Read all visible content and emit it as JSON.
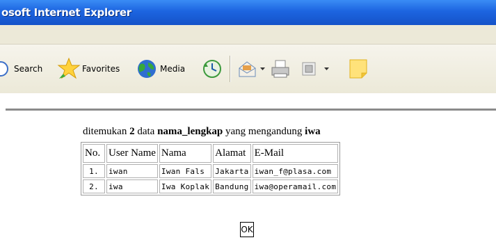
{
  "window": {
    "title": "osoft Internet Explorer"
  },
  "toolbar": {
    "search_label": "Search",
    "favorites_label": "Favorites",
    "media_label": "Media",
    "icons": [
      "search-icon",
      "favorites-star-icon",
      "media-globe-icon",
      "history-icon",
      "mail-icon",
      "print-icon",
      "edit-icon",
      "discuss-icon",
      "messenger-note-icon"
    ]
  },
  "result": {
    "prefix": "ditemukan",
    "count": "2",
    "middle1": "data",
    "field": "nama_lengkap",
    "middle2": "yang mengandung",
    "keyword": "iwa"
  },
  "table": {
    "headers": [
      "No.",
      "User Name",
      "Nama",
      "Alamat",
      "E-Mail"
    ],
    "rows": [
      [
        "1.",
        "iwan",
        "Iwan Fals",
        "Jakarta",
        "iwan_f@plasa.com"
      ],
      [
        "2.",
        "iwa",
        "Iwa Koplak",
        "Bandung",
        "iwa@operamail.com"
      ]
    ]
  },
  "ok_button": "OK",
  "colors": {
    "titlebar": "#1c64e0",
    "toolbar": "#ece9d8"
  }
}
